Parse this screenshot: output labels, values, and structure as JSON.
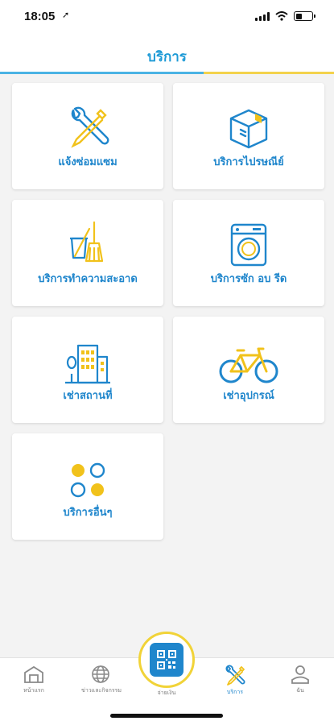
{
  "status_bar": {
    "time": "18:05"
  },
  "header": {
    "title": "บริการ"
  },
  "services": [
    {
      "label": "แจ้งซ่อมแซม",
      "icon": "tools-icon"
    },
    {
      "label": "บริการไปรษณีย์",
      "icon": "parcel-box-icon"
    },
    {
      "label": "บริการทำความสะอาด",
      "icon": "cleaning-broom-icon"
    },
    {
      "label": "บริการซัก อบ รีด",
      "icon": "washing-machine-icon"
    },
    {
      "label": "เช่าสถานที่",
      "icon": "building-icon"
    },
    {
      "label": "เช่าอุปกรณ์",
      "icon": "bicycle-icon"
    },
    {
      "label": "บริการอื่นๆ",
      "icon": "more-circles-icon"
    }
  ],
  "tabbar": {
    "home": "หน้าแรก",
    "news": "ข่าวและกิจกรรม",
    "pay": "จ่ายเงิน",
    "services": "บริการ",
    "me": "ฉัน"
  },
  "colors": {
    "brand_blue": "#1f86cc",
    "accent_yellow": "#f1d338",
    "active_tab": "services"
  }
}
